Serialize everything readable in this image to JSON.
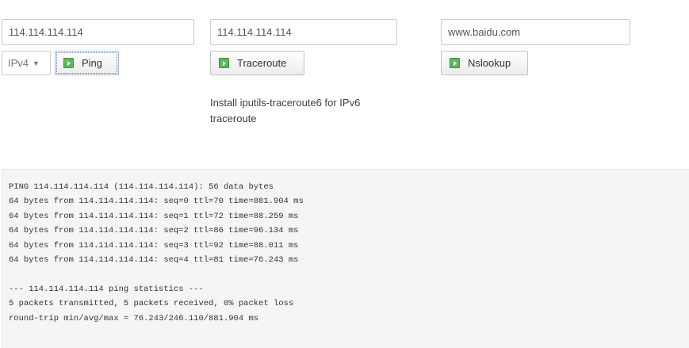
{
  "ping": {
    "host_value": "114.114.114.114",
    "protocol_selected": "IPv4",
    "button_label": "Ping",
    "button_icon": "play-icon"
  },
  "traceroute": {
    "host_value": "114.114.114.114",
    "button_label": "Traceroute",
    "button_icon": "play-icon",
    "hint": "Install iputils-traceroute6 for IPv6 traceroute"
  },
  "nslookup": {
    "host_value": "www.baidu.com",
    "button_label": "Nslookup",
    "button_icon": "play-icon"
  },
  "output": {
    "lines": [
      "PING 114.114.114.114 (114.114.114.114): 56 data bytes",
      "64 bytes from 114.114.114.114: seq=0 ttl=70 time=881.904 ms",
      "64 bytes from 114.114.114.114: seq=1 ttl=72 time=88.259 ms",
      "64 bytes from 114.114.114.114: seq=2 ttl=86 time=96.134 ms",
      "64 bytes from 114.114.114.114: seq=3 ttl=92 time=88.011 ms",
      "64 bytes from 114.114.114.114: seq=4 ttl=81 time=76.243 ms",
      "",
      "--- 114.114.114.114 ping statistics ---",
      "5 packets transmitted, 5 packets received, 0% packet loss",
      "round-trip min/avg/max = 76.243/246.110/881.904 ms"
    ]
  },
  "colors": {
    "icon_green": "#5cb85c",
    "output_background": "#f5f5f5"
  }
}
